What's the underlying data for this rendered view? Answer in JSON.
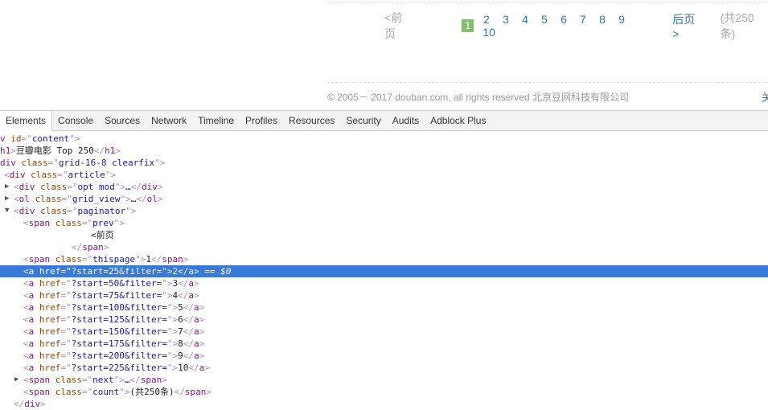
{
  "page": {
    "paginator": {
      "prev": "<前页",
      "current": "1",
      "pages": [
        "2",
        "3",
        "4",
        "5",
        "6",
        "7",
        "8",
        "9",
        "10"
      ],
      "next": "后页>",
      "count": "(共250条)"
    },
    "footer": {
      "copyright": "© 2005－ 2017 douban.com, all rights reserved 北京豆网科技有限公司",
      "more": "关"
    }
  },
  "devtools": {
    "tabs": [
      "Elements",
      "Console",
      "Sources",
      "Network",
      "Timeline",
      "Profiles",
      "Resources",
      "Security",
      "Audits",
      "Adblock Plus"
    ],
    "active_tab": "Elements",
    "selection_color": "#3879d9",
    "lines": [
      {
        "depth": 0,
        "arrow": "",
        "tokens": [
          [
            "tag",
            "v "
          ],
          [
            "an",
            "id"
          ],
          [
            "br",
            "=\""
          ],
          [
            "av",
            "content"
          ],
          [
            "br",
            "\">"
          ]
        ]
      },
      {
        "depth": 0,
        "arrow": "",
        "tokens": [
          [
            "tag",
            "h1"
          ],
          [
            "br",
            ">"
          ],
          [
            "tx",
            "豆瓣电影 Top 250"
          ],
          [
            "br",
            "</"
          ],
          [
            "tag",
            "h1"
          ],
          [
            "br",
            ">"
          ]
        ]
      },
      {
        "depth": 0,
        "arrow": "",
        "tokens": [
          [
            "tag",
            "div "
          ],
          [
            "an",
            "class"
          ],
          [
            "br",
            "=\""
          ],
          [
            "av",
            "grid-16-8 clearfix"
          ],
          [
            "br",
            "\">"
          ]
        ]
      },
      {
        "depth": 1,
        "arrow": "",
        "tokens": [
          [
            "br",
            "<"
          ],
          [
            "tag",
            "div "
          ],
          [
            "an",
            "class"
          ],
          [
            "br",
            "=\""
          ],
          [
            "av",
            "article"
          ],
          [
            "br",
            "\">"
          ]
        ]
      },
      {
        "depth": 2,
        "arrow": "▶",
        "tokens": [
          [
            "br",
            "<"
          ],
          [
            "tag",
            "div "
          ],
          [
            "an",
            "class"
          ],
          [
            "br",
            "=\""
          ],
          [
            "av",
            "opt mod"
          ],
          [
            "br",
            "\">"
          ],
          [
            "tx",
            "…"
          ],
          [
            "br",
            "</"
          ],
          [
            "tag",
            "div"
          ],
          [
            "br",
            ">"
          ]
        ]
      },
      {
        "depth": 2,
        "arrow": "▶",
        "tokens": [
          [
            "br",
            "<"
          ],
          [
            "tag",
            "ol "
          ],
          [
            "an",
            "class"
          ],
          [
            "br",
            "=\""
          ],
          [
            "av",
            "grid_view"
          ],
          [
            "br",
            "\">"
          ],
          [
            "tx",
            "…"
          ],
          [
            "br",
            "</"
          ],
          [
            "tag",
            "ol"
          ],
          [
            "br",
            ">"
          ]
        ]
      },
      {
        "depth": 2,
        "arrow": "▼",
        "tokens": [
          [
            "br",
            "<"
          ],
          [
            "tag",
            "div "
          ],
          [
            "an",
            "class"
          ],
          [
            "br",
            "=\""
          ],
          [
            "av",
            "paginator"
          ],
          [
            "br",
            "\">"
          ]
        ]
      },
      {
        "depth": 3,
        "arrow": "",
        "tokens": [
          [
            "br",
            "<"
          ],
          [
            "tag",
            "span "
          ],
          [
            "an",
            "class"
          ],
          [
            "br",
            "=\""
          ],
          [
            "av",
            "prev"
          ],
          [
            "br",
            "\">"
          ]
        ]
      },
      {
        "depth": 10,
        "arrow": "",
        "tokens": [
          [
            "tx",
            "<前页"
          ]
        ]
      },
      {
        "depth": 8,
        "arrow": "",
        "tokens": [
          [
            "br",
            "</"
          ],
          [
            "tag",
            "span"
          ],
          [
            "br",
            ">"
          ]
        ]
      },
      {
        "depth": 3,
        "arrow": "",
        "tokens": [
          [
            "br",
            "<"
          ],
          [
            "tag",
            "span "
          ],
          [
            "an",
            "class"
          ],
          [
            "br",
            "=\""
          ],
          [
            "av",
            "thispage"
          ],
          [
            "br",
            "\">"
          ],
          [
            "tx",
            "1"
          ],
          [
            "br",
            "</"
          ],
          [
            "tag",
            "span"
          ],
          [
            "br",
            ">"
          ]
        ]
      },
      {
        "depth": 3,
        "arrow": "",
        "selected": true,
        "tokens": [
          [
            "br",
            "<"
          ],
          [
            "tag",
            "a "
          ],
          [
            "an",
            "href"
          ],
          [
            "br",
            "=\""
          ],
          [
            "av",
            "?start=25&filter="
          ],
          [
            "br",
            "\">"
          ],
          [
            "tx",
            "2"
          ],
          [
            "br",
            "</"
          ],
          [
            "tag",
            "a"
          ],
          [
            "br",
            "> "
          ],
          [
            "sel",
            "== $0"
          ]
        ]
      },
      {
        "depth": 3,
        "arrow": "",
        "tokens": [
          [
            "br",
            "<"
          ],
          [
            "tag",
            "a "
          ],
          [
            "an",
            "href"
          ],
          [
            "br",
            "=\""
          ],
          [
            "av",
            "?start=50&filter="
          ],
          [
            "br",
            "\">"
          ],
          [
            "tx",
            "3"
          ],
          [
            "br",
            "</"
          ],
          [
            "tag",
            "a"
          ],
          [
            "br",
            ">"
          ]
        ]
      },
      {
        "depth": 3,
        "arrow": "",
        "tokens": [
          [
            "br",
            "<"
          ],
          [
            "tag",
            "a "
          ],
          [
            "an",
            "href"
          ],
          [
            "br",
            "=\""
          ],
          [
            "av",
            "?start=75&filter="
          ],
          [
            "br",
            "\">"
          ],
          [
            "tx",
            "4"
          ],
          [
            "br",
            "</"
          ],
          [
            "tag",
            "a"
          ],
          [
            "br",
            ">"
          ]
        ]
      },
      {
        "depth": 3,
        "arrow": "",
        "tokens": [
          [
            "br",
            "<"
          ],
          [
            "tag",
            "a "
          ],
          [
            "an",
            "href"
          ],
          [
            "br",
            "=\""
          ],
          [
            "av",
            "?start=100&filter="
          ],
          [
            "br",
            "\">"
          ],
          [
            "tx",
            "5"
          ],
          [
            "br",
            "</"
          ],
          [
            "tag",
            "a"
          ],
          [
            "br",
            ">"
          ]
        ]
      },
      {
        "depth": 3,
        "arrow": "",
        "tokens": [
          [
            "br",
            "<"
          ],
          [
            "tag",
            "a "
          ],
          [
            "an",
            "href"
          ],
          [
            "br",
            "=\""
          ],
          [
            "av",
            "?start=125&filter="
          ],
          [
            "br",
            "\">"
          ],
          [
            "tx",
            "6"
          ],
          [
            "br",
            "</"
          ],
          [
            "tag",
            "a"
          ],
          [
            "br",
            ">"
          ]
        ]
      },
      {
        "depth": 3,
        "arrow": "",
        "tokens": [
          [
            "br",
            "<"
          ],
          [
            "tag",
            "a "
          ],
          [
            "an",
            "href"
          ],
          [
            "br",
            "=\""
          ],
          [
            "av",
            "?start=150&filter="
          ],
          [
            "br",
            "\">"
          ],
          [
            "tx",
            "7"
          ],
          [
            "br",
            "</"
          ],
          [
            "tag",
            "a"
          ],
          [
            "br",
            ">"
          ]
        ]
      },
      {
        "depth": 3,
        "arrow": "",
        "tokens": [
          [
            "br",
            "<"
          ],
          [
            "tag",
            "a "
          ],
          [
            "an",
            "href"
          ],
          [
            "br",
            "=\""
          ],
          [
            "av",
            "?start=175&filter="
          ],
          [
            "br",
            "\">"
          ],
          [
            "tx",
            "8"
          ],
          [
            "br",
            "</"
          ],
          [
            "tag",
            "a"
          ],
          [
            "br",
            ">"
          ]
        ]
      },
      {
        "depth": 3,
        "arrow": "",
        "tokens": [
          [
            "br",
            "<"
          ],
          [
            "tag",
            "a "
          ],
          [
            "an",
            "href"
          ],
          [
            "br",
            "=\""
          ],
          [
            "av",
            "?start=200&filter="
          ],
          [
            "br",
            "\">"
          ],
          [
            "tx",
            "9"
          ],
          [
            "br",
            "</"
          ],
          [
            "tag",
            "a"
          ],
          [
            "br",
            ">"
          ]
        ]
      },
      {
        "depth": 3,
        "arrow": "",
        "tokens": [
          [
            "br",
            "<"
          ],
          [
            "tag",
            "a "
          ],
          [
            "an",
            "href"
          ],
          [
            "br",
            "=\""
          ],
          [
            "av",
            "?start=225&filter="
          ],
          [
            "br",
            "\">"
          ],
          [
            "tx",
            "10"
          ],
          [
            "br",
            "</"
          ],
          [
            "tag",
            "a"
          ],
          [
            "br",
            ">"
          ]
        ]
      },
      {
        "depth": 3,
        "arrow": "▶",
        "tokens": [
          [
            "br",
            "<"
          ],
          [
            "tag",
            "span "
          ],
          [
            "an",
            "class"
          ],
          [
            "br",
            "=\""
          ],
          [
            "av",
            "next"
          ],
          [
            "br",
            "\">"
          ],
          [
            "tx",
            "…"
          ],
          [
            "br",
            "</"
          ],
          [
            "tag",
            "span"
          ],
          [
            "br",
            ">"
          ]
        ]
      },
      {
        "depth": 3,
        "arrow": "",
        "tokens": [
          [
            "br",
            "<"
          ],
          [
            "tag",
            "span "
          ],
          [
            "an",
            "class"
          ],
          [
            "br",
            "=\""
          ],
          [
            "av",
            "count"
          ],
          [
            "br",
            "\">"
          ],
          [
            "tx",
            "(共250条)"
          ],
          [
            "br",
            "</"
          ],
          [
            "tag",
            "span"
          ],
          [
            "br",
            ">"
          ]
        ]
      },
      {
        "depth": 2,
        "arrow": "",
        "tokens": [
          [
            "br",
            "</"
          ],
          [
            "tag",
            "div"
          ],
          [
            "br",
            ">"
          ]
        ]
      }
    ]
  }
}
